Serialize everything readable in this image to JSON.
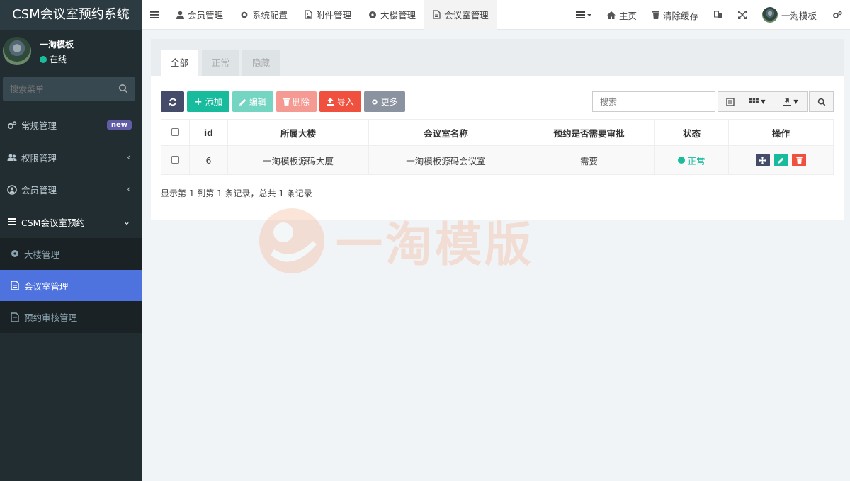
{
  "brand": {
    "title": "CSM会议室预约系统"
  },
  "user": {
    "name": "一淘模板",
    "status": "在线"
  },
  "sidebar": {
    "search_placeholder": "搜索菜单",
    "items": [
      {
        "label": "常规管理",
        "badge": "new"
      },
      {
        "label": "权限管理"
      },
      {
        "label": "会员管理"
      },
      {
        "label": "CSM会议室预约"
      }
    ],
    "subitems": [
      {
        "label": "大楼管理"
      },
      {
        "label": "会议室管理"
      },
      {
        "label": "预约审核管理"
      }
    ]
  },
  "topnav": {
    "tabs": [
      {
        "label": "会员管理"
      },
      {
        "label": "系统配置"
      },
      {
        "label": "附件管理"
      },
      {
        "label": "大楼管理"
      },
      {
        "label": "会议室管理"
      }
    ],
    "home": "主页",
    "clear_cache": "清除缓存",
    "user_name": "一淘模板"
  },
  "content": {
    "filter_tabs": [
      "全部",
      "正常",
      "隐藏"
    ],
    "toolbar": {
      "add": "添加",
      "edit": "编辑",
      "delete": "删除",
      "import": "导入",
      "more": "更多"
    },
    "search_placeholder": "搜索",
    "table": {
      "headers": [
        "id",
        "所属大楼",
        "会议室名称",
        "预约是否需要审批",
        "状态",
        "操作"
      ],
      "rows": [
        {
          "id": "6",
          "building": "一淘模板源码大厦",
          "room": "一淘模板源码会议室",
          "approval": "需要",
          "status": "正常"
        }
      ]
    },
    "pagination": "显示第 1 到第 1 条记录，总共 1 条记录"
  },
  "watermark": {
    "text": "一淘模版"
  },
  "colors": {
    "sidebar": "#222d32",
    "accent": "#4e73df",
    "green": "#18bc9c",
    "red": "#f0513f"
  }
}
